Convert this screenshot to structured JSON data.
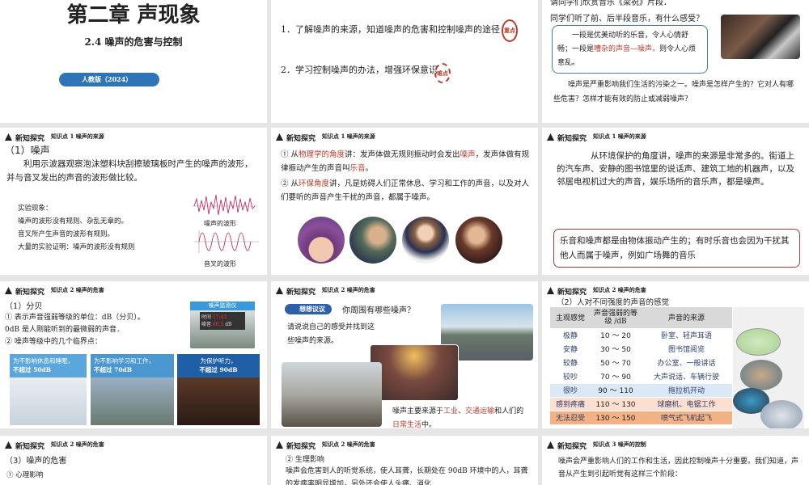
{
  "header_label": "新知探究",
  "s1": {
    "title": "第二章  声现象",
    "subtitle": "2.4   噪声的危害与控制",
    "badge": "人教版（2024）"
  },
  "s2": {
    "goal1": "1．了解噪声的来源，知道噪声的危害和控制噪声的途径",
    "goal2": "2．学习控制噪声的办法，增强环保意识",
    "stamp1": "重点",
    "stamp2": "难点"
  },
  "s3": {
    "intro": "请同学们欣赏音乐《梁祝》片段．",
    "question": "同学们听了前、后半段音乐，有什么感受？",
    "box_a": "一段是优美动听的乐音，令人心情舒畅；一段是",
    "box_red": "嘈杂的声音—噪声，",
    "box_b": "则令人心烦意乱。",
    "para": "噪声是严重影响我们生活的污染之一。噪声是怎样产生的？它对人有哪些危害？怎样才能有效的防止或减弱噪声？"
  },
  "s4": {
    "kp": "知识点 1  噪声的来源",
    "heading": "（1）噪声",
    "para": "利用示波器观察泡沫塑料块刮擦玻璃板时产生的噪声的波形，并与音叉发出的声音的波形做比较。",
    "obs": [
      "实验现象：",
      "噪声的波形没有规则、杂乱无章的。",
      "音叉所产生声音的波形有规则。",
      "大量的实验证明：噪声的波形没有规则"
    ],
    "wave1": "噪声的波形",
    "wave2": "音叉的波形"
  },
  "s5": {
    "kp": "知识点 1  噪声的来源",
    "l1a": "① 从",
    "l1r": "物理学的角度",
    "l1b": "讲：发声体做无规则振动时会发出",
    "l1r2": "噪声",
    "l1c": "，发声体做有规律振动产生的声音叫",
    "l1r3": "乐音",
    "l1d": "。",
    "l2a": "② 从",
    "l2r": "环保角度",
    "l2b": "讲，凡是妨碍人们正常休息、学习和工作的声音，以及对人们要听的声音产生干扰的声音，都属于噪声。"
  },
  "s6": {
    "kp": "知识点 1  噪声的来源",
    "para": "从环境保护的角度讲，噪声的来源是非常多的。街道上的汽车声、安静的图书馆里的说话声、建筑工地的机器声，以及邻居电视机过大的声音，娱乐场所的音乐声，都是噪声。",
    "box": "乐音和噪声都是由物体振动产生的；有时乐音也会因为干扰其他人而属于噪声，例如广场舞的音乐"
  },
  "s7": {
    "kp": "知识点 2  噪声的危害",
    "heading": "（1）分贝",
    "l1": "① 表示声音强弱等级的单位：dB（分贝）。",
    "l2": "0dB  是人刚能听到的最微弱的声音．",
    "l3": "② 噪声等级中的几个临界点：",
    "monitor": {
      "title": "噪声监测仪",
      "time_label": "时间",
      "time": "17:43",
      "noise_label": "噪音",
      "value": "60.5",
      "unit": "dB"
    },
    "panels": [
      {
        "a": "为不影响休息和睡眠，",
        "b": "不超过 50dB"
      },
      {
        "a": "为不影响学习和工作，",
        "b": "不超过 70dB"
      },
      {
        "a": "为保护听力，",
        "b": "不超过 90dB"
      }
    ]
  },
  "s8": {
    "kp": "知识点 2  噪声的危害",
    "tag": "想想议议",
    "q": "你周围有哪些噪声？",
    "ask": "请说说自己的感受并找到这些噪声的来源。",
    "c_a": "噪声主要来源于",
    "c_r1": "工业",
    "c_s": "、",
    "c_r2": "交通运输",
    "c_b": "和人们的",
    "c_r3": "日常生活",
    "c_c": "中。"
  },
  "s9": {
    "kp": "知识点 2  噪声的危害",
    "heading": "（2）人对不同强度的声音的感觉",
    "cols": [
      "主观感觉",
      "声音强弱的等级 /dB",
      "声音的来源"
    ],
    "rows": [
      [
        "极静",
        "10 ～ 20",
        "卧室、轻声耳语"
      ],
      [
        "安静",
        "30 ～ 50",
        "图书馆阅览"
      ],
      [
        "较静",
        "50 ～ 70",
        "办公室、一般讲话"
      ],
      [
        "较吵",
        "70 ～ 90",
        "大声说话、车辆行驶"
      ],
      [
        "很吵",
        "90 ～ 110",
        "拖拉机开动"
      ],
      [
        "感到疼痛",
        "110 ～ 130",
        "球磨机、电锯工作"
      ],
      [
        "无法忍受",
        "130 ～ 150",
        "喷气式飞机起飞"
      ]
    ],
    "row_colors": [
      "#ffffff",
      "#ffffff",
      "#ffffff",
      "#ffffff",
      "#dbe8f5",
      "#fbe0d2",
      "#f4b183"
    ]
  },
  "s10": {
    "kp": "知识点 2  噪声的危害",
    "heading": "（3）噪声的危害",
    "l1": "① 心理影响"
  },
  "s11": {
    "kp": "知识点 2  噪声的危害",
    "l1": "② 生理影响",
    "para": "噪声会危害到人的听觉系统，使人耳聋，长期处在 90dB 环境中的人，耳聋的发病率明显增加，另外还会使人头痛、消化"
  },
  "s12": {
    "kp": "知识点 3  噪声的控制",
    "para": "噪声会严重影响人们的工作和生活，因此控制噪声十分重要。我们知道，声音从产生到引起听觉有这样三个阶段："
  }
}
